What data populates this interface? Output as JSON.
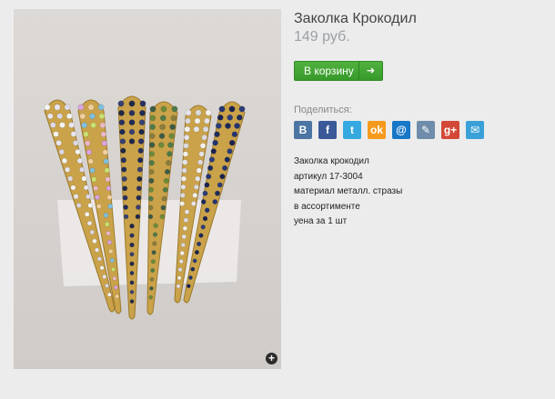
{
  "product": {
    "title": "Заколка Крокодил",
    "price": "149 руб."
  },
  "cart_button": {
    "label": "В корзину",
    "arrow_icon": "arrow-right-icon"
  },
  "share": {
    "label": "Поделиться:",
    "services": [
      {
        "name": "vkontakte",
        "glyph": "В",
        "color": "#4c75a3"
      },
      {
        "name": "facebook",
        "glyph": "f",
        "color": "#3b5998"
      },
      {
        "name": "twitter",
        "glyph": "t",
        "color": "#35a9e0"
      },
      {
        "name": "odnoklassniki",
        "glyph": "ok",
        "color": "#f59a1d"
      },
      {
        "name": "mailru",
        "glyph": "@",
        "color": "#1877c6"
      },
      {
        "name": "livejournal",
        "glyph": "✎",
        "color": "#6f8dab"
      },
      {
        "name": "googleplus",
        "glyph": "g+",
        "color": "#d34836"
      },
      {
        "name": "email",
        "glyph": "✉",
        "color": "#3aa0d8"
      }
    ]
  },
  "description": [
    "Заколка крокодил",
    "артикул 17-3004",
    "материал металл. стразы",
    "в ассортименте",
    "уена за 1 шт"
  ],
  "image": {
    "zoom_glyph": "+"
  }
}
